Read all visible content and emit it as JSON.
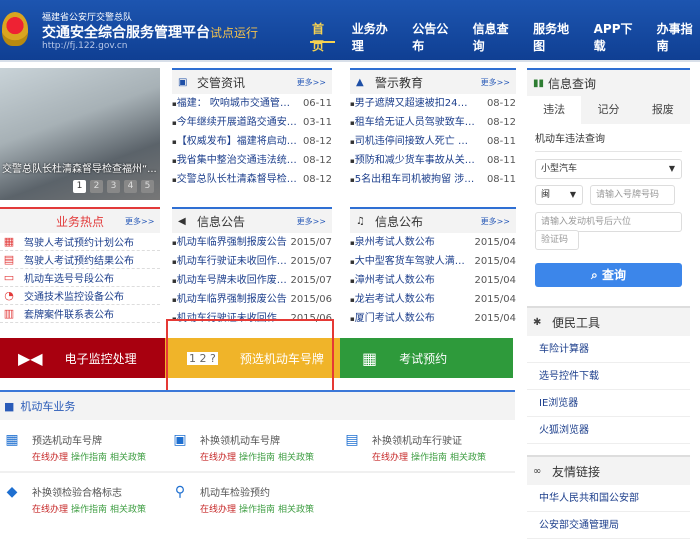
{
  "header": {
    "org": "福建省公安厅交警总队",
    "title": "交通安全综合服务管理平台",
    "badge": "试点运行",
    "url": "http://fj.122.gov.cn",
    "nav": [
      "首页",
      "业务办理",
      "公告公布",
      "信息查询",
      "服务地图",
      "APP下载",
      "办事指南"
    ],
    "active_nav": "首页"
  },
  "carousel": {
    "caption": "交警总队长杜清森督导检查福州“...",
    "pages": [
      "1",
      "2",
      "3",
      "4",
      "5"
    ],
    "current": "1"
  },
  "hot": {
    "title": "业务热点",
    "more": "更多>>",
    "items": [
      {
        "icon": "calendar-icon",
        "label": "驾驶人考试预约计划公布"
      },
      {
        "icon": "result-icon",
        "label": "驾驶人考试预约结果公布"
      },
      {
        "icon": "plate-icon",
        "label": "机动车选号号段公布"
      },
      {
        "icon": "camera-icon",
        "label": "交通技术监控设备公布"
      },
      {
        "icon": "table-icon",
        "label": "套牌案件联系表公布"
      }
    ]
  },
  "news": {
    "title": "交管资讯",
    "more": "更多>>",
    "items": [
      {
        "t": "福建： 吹响城市交通管理“...",
        "d": "06-11"
      },
      {
        "t": "今年继续开展道路交通安全...",
        "d": "03-11"
      },
      {
        "t": "【权威发布】福建将启动最...",
        "d": "08-12"
      },
      {
        "t": "我省集中整治交通违法统一...",
        "d": "08-12"
      },
      {
        "t": "交警总队长杜清森督导检查...",
        "d": "08-12"
      }
    ]
  },
  "warning": {
    "title": "警示教育",
    "more": "更多>>",
    "items": [
      {
        "t": "男子遮牌又超速被扣24分 自...",
        "d": "08-12"
      },
      {
        "t": "租车给无证人员驾驶致车祸 ...",
        "d": "08-12"
      },
      {
        "t": "司机违停间接致人死亡 害怕...",
        "d": "08-11"
      },
      {
        "t": "预防和减少货车事故从关注...",
        "d": "08-11"
      },
      {
        "t": "5名出租车司机被拘留 涉带...",
        "d": "08-11"
      }
    ]
  },
  "notice": {
    "title": "信息公告",
    "more": "更多>>",
    "items": [
      {
        "t": "机动车临界强制报废公告",
        "d": "2015/07"
      },
      {
        "t": "机动车行驶证未收回作废公告",
        "d": "2015/07"
      },
      {
        "t": "机动车号牌未收回作废公告",
        "d": "2015/07"
      },
      {
        "t": "机动车临界强制报废公告",
        "d": "2015/06"
      },
      {
        "t": "机动车行驶证未收回作废公告",
        "d": "2015/06"
      }
    ]
  },
  "publish": {
    "title": "信息公布",
    "more": "更多>>",
    "items": [
      {
        "t": "泉州考试人数公布",
        "d": "2015/04"
      },
      {
        "t": "大中型客货车驾驶人满分公布",
        "d": "2015/04"
      },
      {
        "t": "漳州考试人数公布",
        "d": "2015/04"
      },
      {
        "t": "龙岩考试人数公布",
        "d": "2015/04"
      },
      {
        "t": "厦门考试人数公布",
        "d": "2015/04"
      }
    ]
  },
  "banners": [
    {
      "label": "电子监控处理",
      "color": "#a8000f"
    },
    {
      "label": "预选机动车号牌",
      "color": "#f0b429"
    },
    {
      "label": "考试预约",
      "color": "#2e9a3b"
    }
  ],
  "vehicle": {
    "title": "机动车业务",
    "links": {
      "a": "在线办理",
      "b": "操作指南",
      "c": "相关政策"
    },
    "items": [
      "预选机动车号牌",
      "补换领机动车号牌",
      "补换领机动车行驶证",
      "补换领检验合格标志",
      "机动车检验预约"
    ]
  },
  "query": {
    "title": "信息查询",
    "tabs": [
      "违法",
      "记分",
      "报废"
    ],
    "active_tab": "违法",
    "subtitle": "机动车违法查询",
    "vehicle_type": "小型汽车",
    "province": "闽",
    "plate_placeholder": "请输入号牌号码",
    "engine_placeholder": "请输入发动机号后六位",
    "captcha_placeholder": "验证码",
    "submit": "查询"
  },
  "tools": {
    "title": "便民工具",
    "items": [
      "车险计算器",
      "选号控件下载",
      "IE浏览器",
      "火狐浏览器"
    ]
  },
  "links": {
    "title": "友情链接",
    "items": [
      "中华人民共和国公安部",
      "公安部交通管理局"
    ]
  },
  "colors": {
    "brand": "#1d55b0",
    "accent": "#3c86ea",
    "hot": "#e23a3a"
  }
}
